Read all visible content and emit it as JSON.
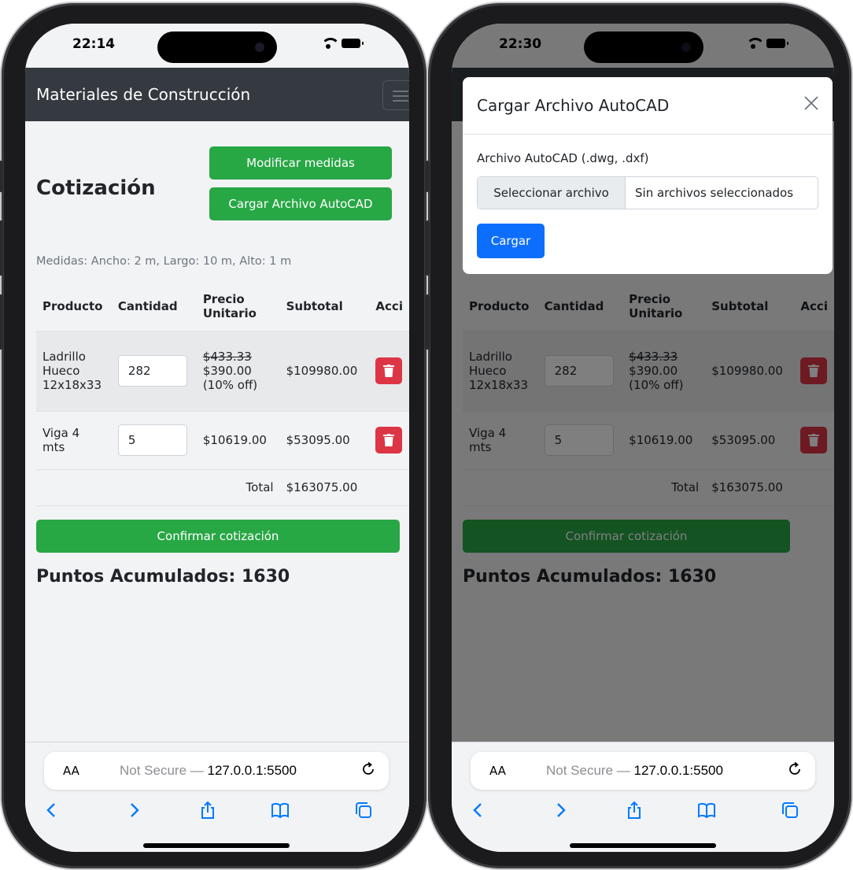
{
  "left_phone": {
    "status": {
      "time": "22:14"
    },
    "navbar": {
      "brand": "Materiales de Construcción"
    },
    "page": {
      "title": "Cotización",
      "modify_button": "Modificar medidas",
      "upload_button": "Cargar Archivo AutoCAD",
      "measures": "Medidas: Ancho: 2 m, Largo: 10 m, Alto: 1 m",
      "table": {
        "headers": [
          "Producto",
          "Cantidad",
          "Precio Unitario",
          "Subtotal",
          "Acci"
        ],
        "rows": [
          {
            "product": "Ladrillo Hueco 12x18x33",
            "qty": "282",
            "old_price": "$433.33",
            "price": "$390.00",
            "discount": "(10% off)",
            "subtotal": "$109980.00"
          },
          {
            "product": "Viga 4 mts",
            "qty": "5",
            "old_price": "",
            "price": "$10619.00",
            "discount": "",
            "subtotal": "$53095.00"
          }
        ],
        "total_label": "Total",
        "total_value": "$163075.00"
      },
      "confirm_button": "Confirmar cotización",
      "points": "Puntos Acumulados: 1630"
    },
    "browser": {
      "aa": "AA",
      "not_secure": "Not Secure —",
      "host": "127.0.0.1:5500"
    }
  },
  "right_phone": {
    "status": {
      "time": "22:30"
    },
    "modal": {
      "title": "Cargar Archivo AutoCAD",
      "field_label": "Archivo AutoCAD (.dwg, .dxf)",
      "choose_button": "Seleccionar archivo",
      "no_file": "Sin archivos seleccionados",
      "submit_button": "Cargar"
    },
    "page": {
      "table": {
        "headers": [
          "Producto",
          "Cantidad",
          "Precio Unitario",
          "Subtotal",
          "Acci"
        ],
        "rows": [
          {
            "product": "Ladrillo Hueco 12x18x33",
            "qty": "282",
            "old_price": "$433.33",
            "price": "$390.00",
            "discount": "(10% off)",
            "subtotal": "$109980.00"
          },
          {
            "product": "Viga 4 mts",
            "qty": "5",
            "old_price": "",
            "price": "$10619.00",
            "discount": "",
            "subtotal": "$53095.00"
          }
        ],
        "total_label": "Total",
        "total_value": "$163075.00"
      },
      "confirm_button": "Confirmar cotización",
      "points": "Puntos Acumulados: 1630"
    },
    "browser": {
      "aa": "AA",
      "not_secure": "Not Secure —",
      "host": "127.0.0.1:5500"
    }
  },
  "colors": {
    "navbar": "#343a40",
    "success": "#28a745",
    "danger": "#dc3545",
    "primary": "#0d6efd",
    "browser_blue": "#007aff"
  },
  "icons": [
    "wifi-icon",
    "battery-icon",
    "menu-icon",
    "trash-icon",
    "close-icon",
    "reload-icon",
    "back-icon",
    "forward-icon",
    "share-icon",
    "bookmarks-icon",
    "tabs-icon"
  ]
}
